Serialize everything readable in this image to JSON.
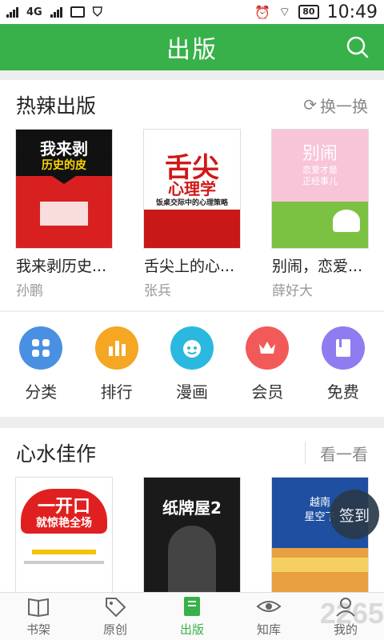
{
  "status_bar": {
    "signal1": "G",
    "signal2": "4G",
    "battery": "80",
    "time": "10:49"
  },
  "header": {
    "title": "出版",
    "search_icon": "search-icon"
  },
  "hot_section": {
    "title": "热辣出版",
    "action": "换一换",
    "books": [
      {
        "title": "我来剥历史...",
        "author": "孙鹏",
        "cover_lines": [
          "我来剥",
          "历史的皮"
        ]
      },
      {
        "title": "舌尖上的心...",
        "author": "张兵",
        "cover_lines": [
          "舌尖",
          "心理学",
          "饭桌交际中的心理策略"
        ]
      },
      {
        "title": "别闹，恋爱...",
        "author": "薛好大",
        "cover_lines": [
          "别闹",
          "恋爱才是",
          "正经事儿"
        ]
      }
    ]
  },
  "categories": [
    {
      "label": "分类",
      "icon": "grid-icon",
      "color": "#4a90e2"
    },
    {
      "label": "排行",
      "icon": "bar-chart-icon",
      "color": "#f5a623"
    },
    {
      "label": "漫画",
      "icon": "face-icon",
      "color": "#2bb8e0"
    },
    {
      "label": "会员",
      "icon": "crown-icon",
      "color": "#f25a5a"
    },
    {
      "label": "免费",
      "icon": "book-icon",
      "color": "#8e7cf0"
    }
  ],
  "picks_section": {
    "title": "心水佳作",
    "action": "看一看",
    "books": [
      {
        "cover_lines": [
          "一开口",
          "就惊艳全场"
        ]
      },
      {
        "cover_lines": [
          "纸牌屋2"
        ]
      },
      {
        "cover_lines": [
          "越南",
          "星空下"
        ]
      }
    ]
  },
  "float_button": "签到",
  "tabs": [
    {
      "label": "书架",
      "icon": "bookshelf-icon"
    },
    {
      "label": "原创",
      "icon": "tag-icon"
    },
    {
      "label": "出版",
      "icon": "book-icon",
      "active": true
    },
    {
      "label": "知库",
      "icon": "eye-icon"
    },
    {
      "label": "我的",
      "icon": "user-icon"
    }
  ],
  "watermark": "2265",
  "colors": {
    "primary": "#38b14a"
  }
}
